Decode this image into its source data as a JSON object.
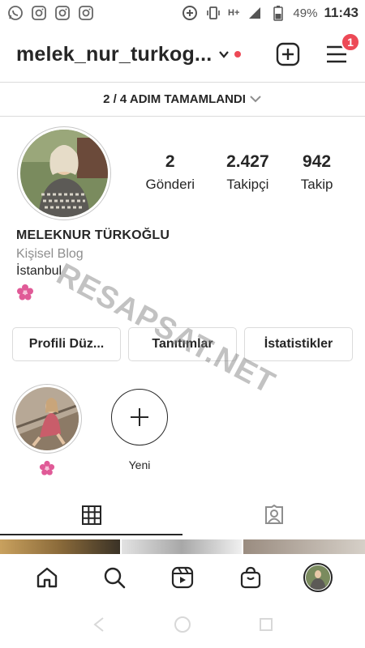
{
  "status_bar": {
    "battery": "49%",
    "time": "11:43",
    "network": "H+"
  },
  "header": {
    "username": "melek_nur_turkog...",
    "notification_count": "1"
  },
  "steps_banner": "2 / 4 ADIM TAMAMLANDI",
  "profile": {
    "posts_count": "2",
    "posts_label": "Gönderi",
    "followers_count": "2.427",
    "followers_label": "Takipçi",
    "following_count": "942",
    "following_label": "Takip",
    "display_name": "MELEKNUR TÜRKOĞLU",
    "category": "Kişisel Blog",
    "city": "İstanbul"
  },
  "buttons": {
    "edit_profile": "Profili Düz...",
    "promotions": "Tanıtımlar",
    "insights": "İstatistikler"
  },
  "highlights": [
    {
      "label": ""
    },
    {
      "label": "Yeni"
    }
  ],
  "watermark": "RESAPSAT.NET",
  "colors": {
    "accent_red": "#ed4956",
    "text": "#262626",
    "muted": "#8e8e8e",
    "border": "#dbdbdb"
  }
}
